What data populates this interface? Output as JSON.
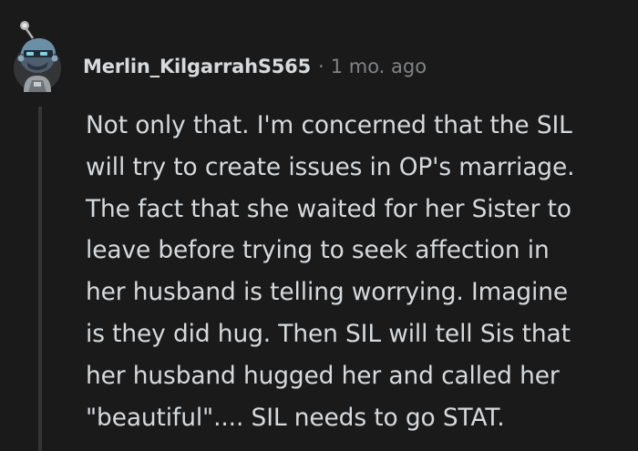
{
  "comment": {
    "author": "Merlin_KilgarrahS565",
    "separator": "·",
    "age": "1 mo. ago",
    "lines": [
      "Not only that. I'm concerned that the SIL",
      "will try to create issues in OP's marriage.",
      "The fact that she waited for her Sister to",
      "leave before trying to seek affection in",
      "her husband is telling worrying. Imagine",
      "is they did hug. Then SIL will tell Sis that",
      "her husband hugged her and called her",
      "\"beautiful\".... SIL needs to go STAT."
    ]
  },
  "colors": {
    "background": "#1a1a1b",
    "text_primary": "#d7dadc",
    "text_secondary": "#818384",
    "thread_line": "#343536"
  },
  "icons": {
    "avatar": "snoo-avatar-icon"
  }
}
